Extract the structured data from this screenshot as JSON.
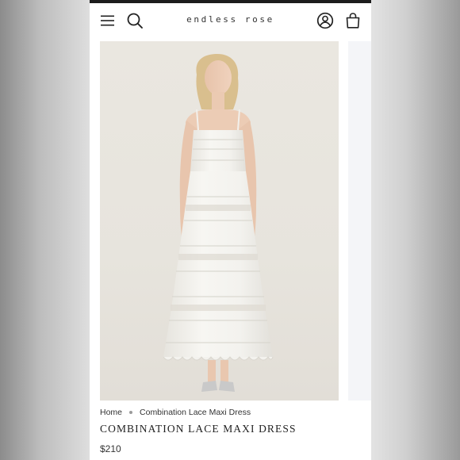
{
  "header": {
    "brand": "endless rose",
    "menu_icon": "hamburger-menu-icon",
    "search_icon": "search-icon",
    "account_icon": "account-icon",
    "bag_icon": "shopping-bag-icon"
  },
  "product": {
    "image_alt": "Model wearing white lace maxi dress",
    "breadcrumb": [
      "Home",
      "Combination Lace Maxi Dress"
    ],
    "title": "COMBINATION LACE MAXI DRESS",
    "price": "$210"
  },
  "colors": {
    "header_bar": "#1c1c1c",
    "text": "#222222",
    "image_bg": "#e7e4dd",
    "dress": "#f4f3ef"
  }
}
